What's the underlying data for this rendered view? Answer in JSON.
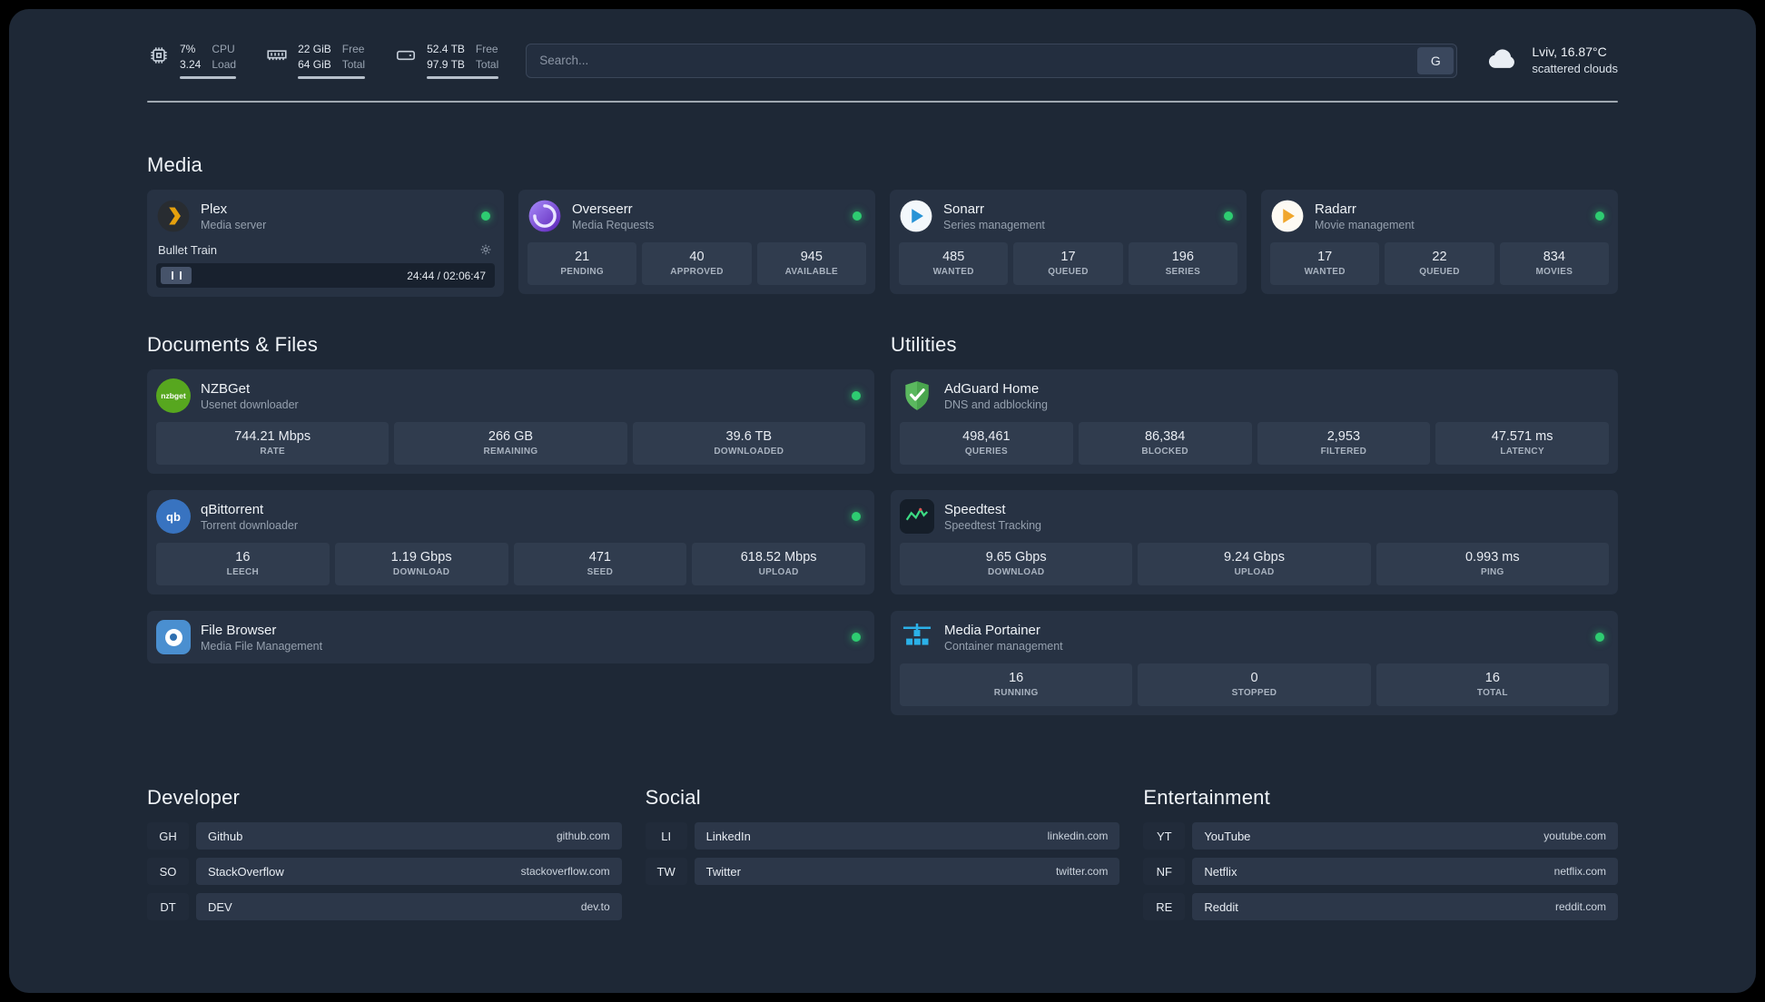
{
  "colors": {
    "background": "#1e2836",
    "card": "#273243",
    "status_online": "#2ecc71",
    "plex_brand": "#e5a00d",
    "sonarr_brand": "#2793d6",
    "radarr_brand": "#f0a62c",
    "overseerr_brand": "#7b5cf0",
    "nzbget_brand": "#57a71f",
    "qbittorrent_brand": "#3873c0",
    "adguard_brand": "#5bb85f",
    "portainer_brand": "#2bb1e8"
  },
  "topbar": {
    "resources": [
      {
        "icon": "cpu-icon",
        "values": [
          "7%",
          "3.24"
        ],
        "labels": [
          "CPU",
          "Load"
        ]
      },
      {
        "icon": "memory-icon",
        "values": [
          "22 GiB",
          "64 GiB"
        ],
        "labels": [
          "Free",
          "Total"
        ]
      },
      {
        "icon": "disk-icon",
        "values": [
          "52.4 TB",
          "97.9 TB"
        ],
        "labels": [
          "Free",
          "Total"
        ]
      }
    ],
    "search": {
      "placeholder": "Search...",
      "provider_button": "G"
    },
    "weather": {
      "location": "Lviv, 16.87°C",
      "condition": "scattered clouds"
    }
  },
  "media": {
    "title": "Media",
    "plex": {
      "name": "Plex",
      "subtitle": "Media server",
      "now_playing": "Bullet Train",
      "time": "24:44 / 02:06:47"
    },
    "overseerr": {
      "name": "Overseerr",
      "subtitle": "Media Requests",
      "stats": [
        {
          "value": "21",
          "label": "PENDING"
        },
        {
          "value": "40",
          "label": "APPROVED"
        },
        {
          "value": "945",
          "label": "AVAILABLE"
        }
      ]
    },
    "sonarr": {
      "name": "Sonarr",
      "subtitle": "Series management",
      "stats": [
        {
          "value": "485",
          "label": "WANTED"
        },
        {
          "value": "17",
          "label": "QUEUED"
        },
        {
          "value": "196",
          "label": "SERIES"
        }
      ]
    },
    "radarr": {
      "name": "Radarr",
      "subtitle": "Movie management",
      "stats": [
        {
          "value": "17",
          "label": "WANTED"
        },
        {
          "value": "22",
          "label": "QUEUED"
        },
        {
          "value": "834",
          "label": "MOVIES"
        }
      ]
    }
  },
  "documents": {
    "title": "Documents & Files",
    "nzbget": {
      "name": "NZBGet",
      "subtitle": "Usenet downloader",
      "icon_text": "nzbget",
      "stats": [
        {
          "value": "744.21 Mbps",
          "label": "RATE"
        },
        {
          "value": "266 GB",
          "label": "REMAINING"
        },
        {
          "value": "39.6 TB",
          "label": "DOWNLOADED"
        }
      ]
    },
    "qbittorrent": {
      "name": "qBittorrent",
      "subtitle": "Torrent downloader",
      "icon_text": "qb",
      "stats": [
        {
          "value": "16",
          "label": "LEECH"
        },
        {
          "value": "1.19 Gbps",
          "label": "DOWNLOAD"
        },
        {
          "value": "471",
          "label": "SEED"
        },
        {
          "value": "618.52 Mbps",
          "label": "UPLOAD"
        }
      ]
    },
    "filebrowser": {
      "name": "File Browser",
      "subtitle": "Media File Management"
    }
  },
  "utilities": {
    "title": "Utilities",
    "adguard": {
      "name": "AdGuard Home",
      "subtitle": "DNS and adblocking",
      "stats": [
        {
          "value": "498,461",
          "label": "QUERIES"
        },
        {
          "value": "86,384",
          "label": "BLOCKED"
        },
        {
          "value": "2,953",
          "label": "FILTERED"
        },
        {
          "value": "47.571 ms",
          "label": "LATENCY"
        }
      ]
    },
    "speedtest": {
      "name": "Speedtest",
      "subtitle": "Speedtest Tracking",
      "stats": [
        {
          "value": "9.65 Gbps",
          "label": "DOWNLOAD"
        },
        {
          "value": "9.24 Gbps",
          "label": "UPLOAD"
        },
        {
          "value": "0.993 ms",
          "label": "PING"
        }
      ]
    },
    "portainer": {
      "name": "Media Portainer",
      "subtitle": "Container management",
      "stats": [
        {
          "value": "16",
          "label": "RUNNING"
        },
        {
          "value": "0",
          "label": "STOPPED"
        },
        {
          "value": "16",
          "label": "TOTAL"
        }
      ]
    }
  },
  "bookmarks": {
    "developer": {
      "title": "Developer",
      "links": [
        {
          "abbr": "GH",
          "name": "Github",
          "domain": "github.com"
        },
        {
          "abbr": "SO",
          "name": "StackOverflow",
          "domain": "stackoverflow.com"
        },
        {
          "abbr": "DT",
          "name": "DEV",
          "domain": "dev.to"
        }
      ]
    },
    "social": {
      "title": "Social",
      "links": [
        {
          "abbr": "LI",
          "name": "LinkedIn",
          "domain": "linkedin.com"
        },
        {
          "abbr": "TW",
          "name": "Twitter",
          "domain": "twitter.com"
        }
      ]
    },
    "entertainment": {
      "title": "Entertainment",
      "links": [
        {
          "abbr": "YT",
          "name": "YouTube",
          "domain": "youtube.com"
        },
        {
          "abbr": "NF",
          "name": "Netflix",
          "domain": "netflix.com"
        },
        {
          "abbr": "RE",
          "name": "Reddit",
          "domain": "reddit.com"
        }
      ]
    }
  }
}
